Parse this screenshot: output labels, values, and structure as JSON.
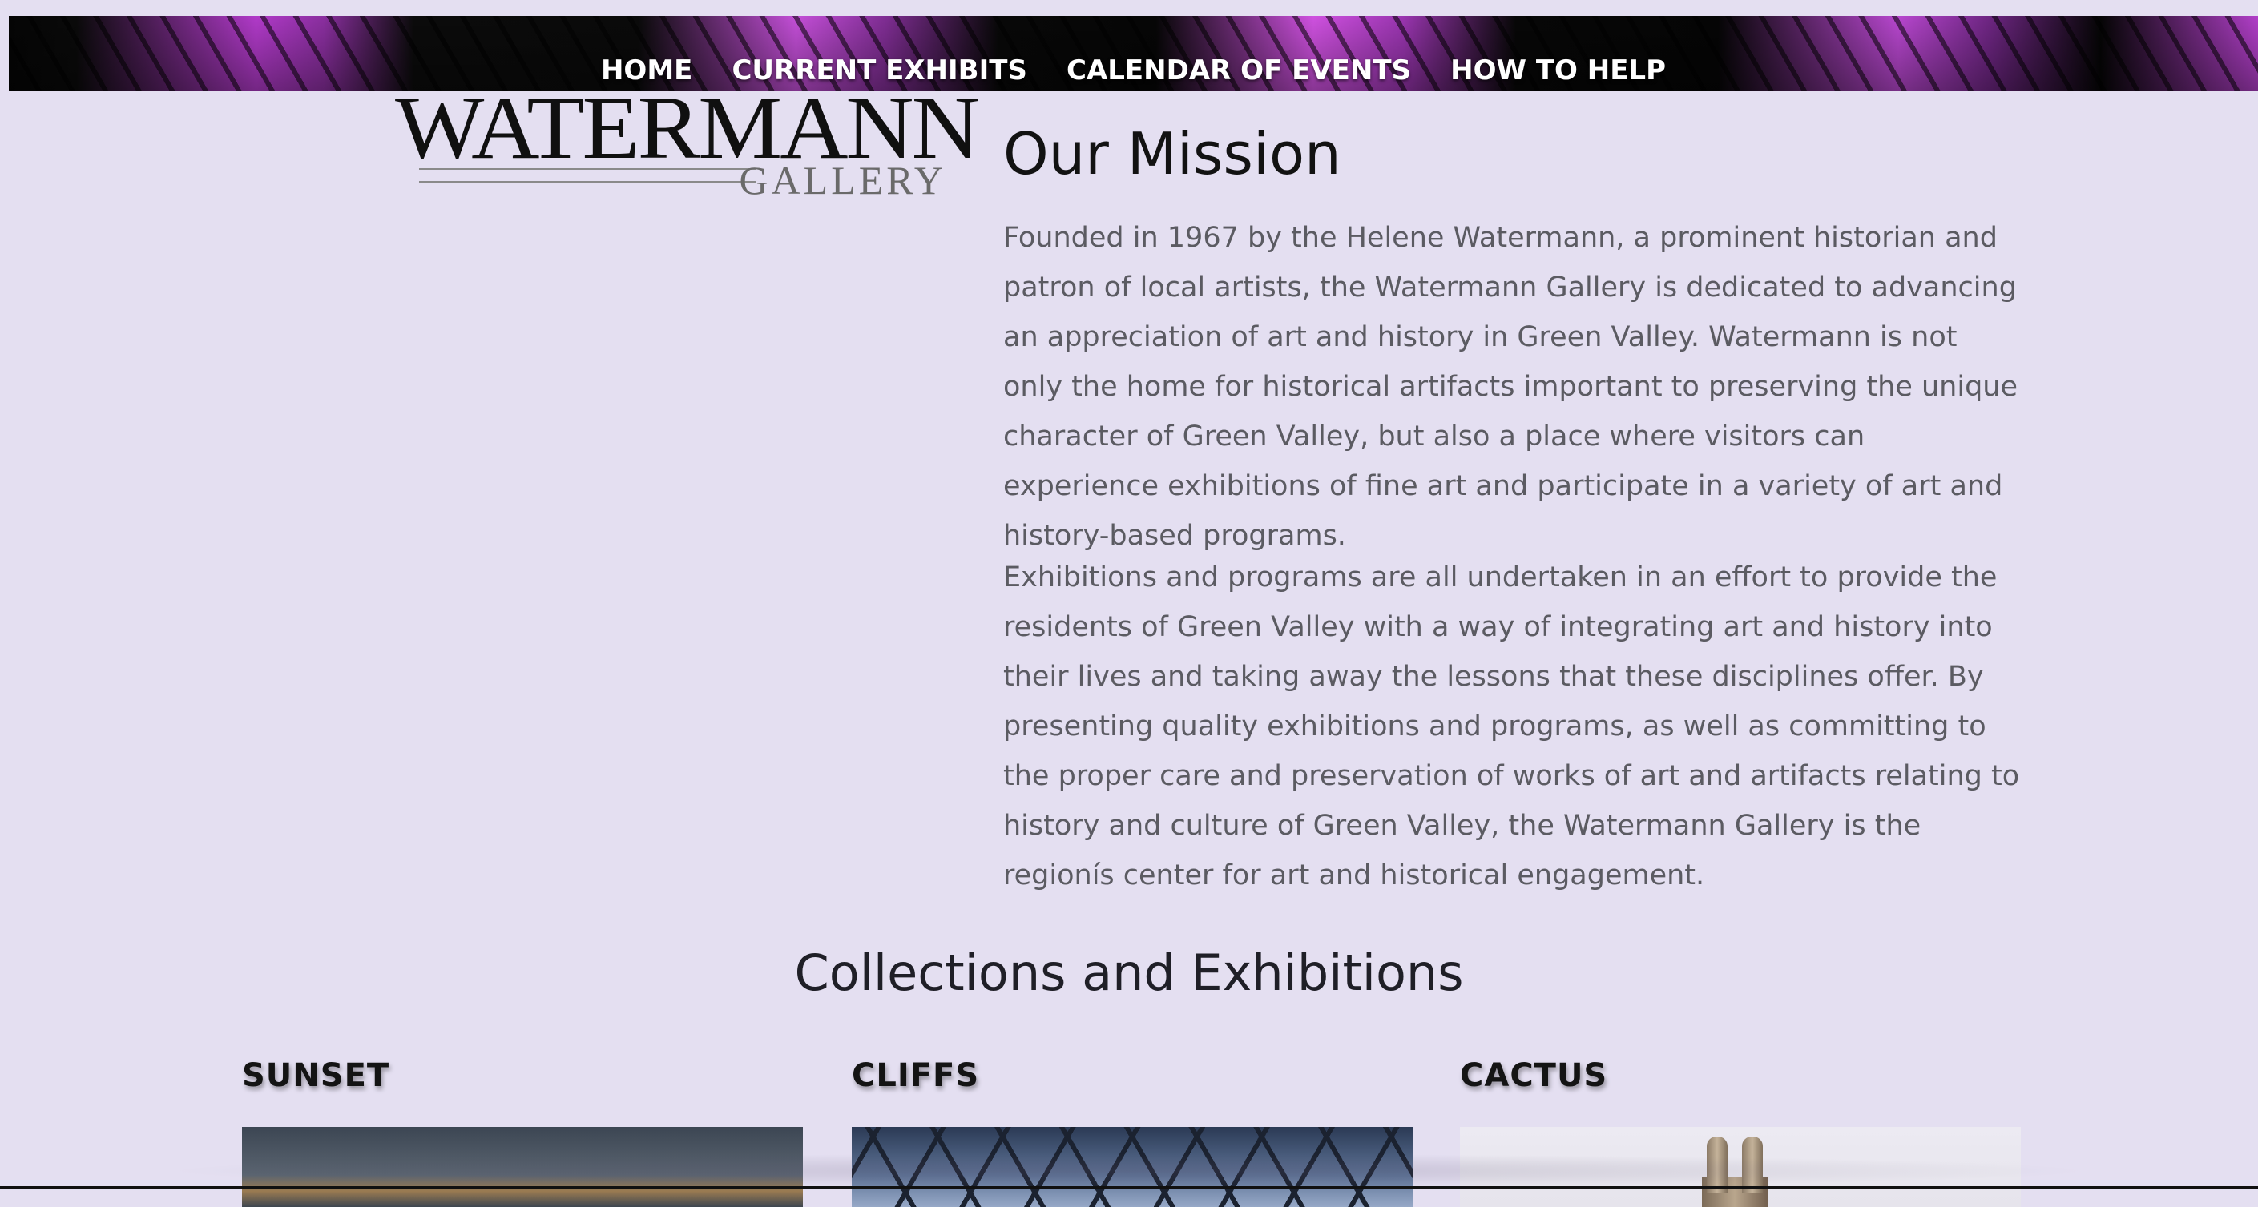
{
  "nav": {
    "items": [
      {
        "label": "HOME"
      },
      {
        "label": "CURRENT EXHIBITS"
      },
      {
        "label": "CALENDAR OF EVENTS"
      },
      {
        "label": "HOW TO HELP"
      }
    ]
  },
  "logo": {
    "main": "WATERMANN",
    "sub": "GALLERY"
  },
  "mission": {
    "title": "Our Mission",
    "paragraph1": "Founded in 1967 by the Helene Watermann, a prominent historian and patron of local artists, the Watermann Gallery is dedicated to advancing an appreciation of art and history in Green Valley. Watermann is not only the home for historical artifacts important to preserving the unique character of Green Valley, but also a place where visitors can experience exhibitions of fine art and participate in a variety of art and history-based programs.",
    "paragraph2": "Exhibitions and programs are all undertaken in an effort to provide the residents of Green Valley with a way of integrating art and history into their lives and taking away the lessons that these disciplines offer. By presenting quality exhibitions and programs, as well as committing to the proper care and preservation of works of art and artifacts relating to history and culture of Green Valley, the Watermann Gallery is the regionís center for art and historical engagement."
  },
  "collections": {
    "title": "Collections and Exhibitions",
    "cards": [
      {
        "label": "SUNSET",
        "image": "sunset-photo"
      },
      {
        "label": "CLIFFS",
        "image": "cliffs-glass-dome-photo"
      },
      {
        "label": "CACTUS",
        "image": "cactus-tower-photo"
      }
    ]
  },
  "colors": {
    "page_background": "#e4dff1",
    "nav_accent": "#c44fd8",
    "text_body": "#5b5b62",
    "text_heading": "#121212"
  }
}
